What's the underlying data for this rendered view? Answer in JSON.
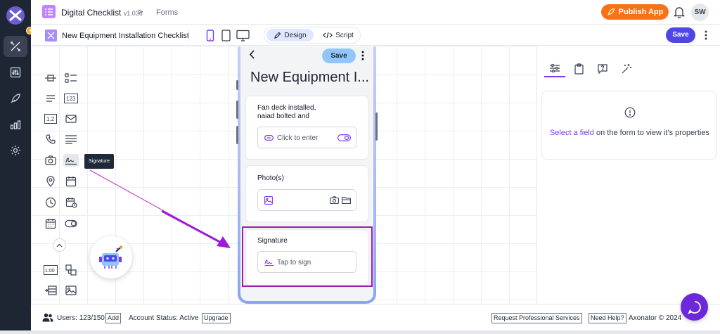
{
  "topbar": {
    "app_title": "Digital Checklist",
    "app_version": "v1.036",
    "breadcrumb_sep": ">",
    "breadcrumb_forms": "Forms",
    "publish_label": "Publish App",
    "avatar_initials": "SW",
    "notification_count": "9"
  },
  "subbar": {
    "form_title": "New Equipment Installation Checklist",
    "design_label": "Design",
    "script_label": "Script",
    "save_label": "Save"
  },
  "palette": {
    "tooltip": "Signature"
  },
  "phone": {
    "back": "<",
    "save_label": "Save",
    "title": "New Equipment I...",
    "card1_label_line1": "Fan deck installed,",
    "card1_label_line2": "naiad bolted and",
    "card1_placeholder": "Click to enter",
    "card2_label": "Photo(s)",
    "card3_label": "Signature",
    "card3_placeholder": "Tap to sign"
  },
  "properties": {
    "link_text": "Select a field",
    "message": " on the form to view it's properties"
  },
  "footer": {
    "users": "Users: 123/150",
    "add_label": "Add",
    "account_status": "Account Status: Active",
    "upgrade_label": "Upgrade",
    "request_services": "Request Professional Services",
    "need_help": "Need Help?",
    "copyright": "Axonator © 2024"
  },
  "colors": {
    "rail": "#1e2533",
    "accent": "#7c3aed",
    "publish": "#f97316",
    "save": "#4f46e5",
    "selection": "#a21caf",
    "arrow": "#a21caf"
  }
}
